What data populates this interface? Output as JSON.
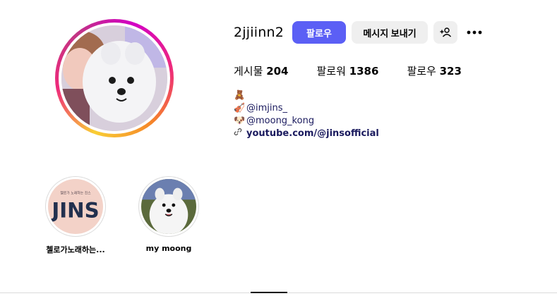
{
  "profile": {
    "username": "2jjiinn2",
    "follow_label": "팔로우",
    "message_label": "메시지 보내기",
    "add_user_icon": "add-person-icon",
    "more_icon": "ellipsis-icon"
  },
  "stats": {
    "posts_label": "게시물",
    "posts_value": "204",
    "followers_label": "팔로워",
    "followers_value": "1386",
    "following_label": "팔로우",
    "following_value": "323"
  },
  "bio": {
    "line1_emoji": "🧸",
    "line2_emoji": "🎻",
    "line2_mention": "@imjins_",
    "line3_emoji": "🐶",
    "line3_mention": "@moong_kong",
    "link_icon": "link-icon",
    "link_text": "youtube.com/@jinsofficial"
  },
  "highlights": [
    {
      "label": "첼로가노래하는...",
      "cover_text": "JINS",
      "cover_subtext": "첼로가 노래하는 진스"
    },
    {
      "label": "my moong"
    }
  ],
  "colors": {
    "follow_button": "#5b5ff5",
    "secondary_button": "#efefef",
    "link": "#1a1a5e"
  }
}
